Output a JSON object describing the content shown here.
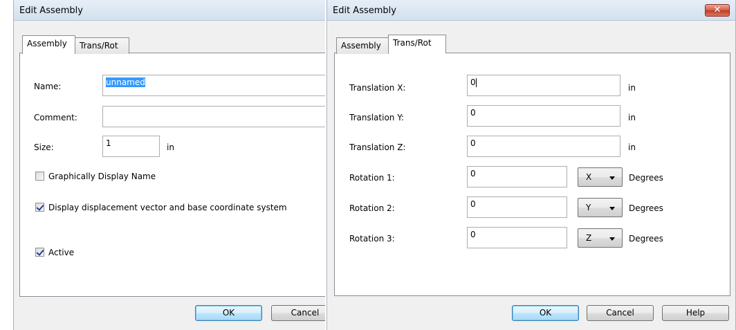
{
  "left_dialog": {
    "title": "Edit Assembly",
    "tabs": [
      {
        "label": "Assembly",
        "active": true
      },
      {
        "label": "Trans/Rot",
        "active": false
      }
    ],
    "fields": {
      "name_label": "Name:",
      "name_value": "unnamed",
      "comment_label": "Comment:",
      "comment_value": "",
      "size_label": "Size:",
      "size_value": "1",
      "size_unit": "in"
    },
    "checkboxes": [
      {
        "label": "Graphically Display Name",
        "checked": false
      },
      {
        "label": "Display displacement vector and base coordinate system",
        "checked": true
      },
      {
        "label": "Active",
        "checked": true
      }
    ],
    "buttons": {
      "ok": "OK",
      "cancel": "Cancel"
    }
  },
  "right_dialog": {
    "title": "Edit Assembly",
    "close_icon": "x-close-icon",
    "tabs": [
      {
        "label": "Assembly",
        "active": false
      },
      {
        "label": "Trans/Rot",
        "active": true
      }
    ],
    "translations": [
      {
        "label": "Translation X:",
        "value": "0",
        "unit": "in"
      },
      {
        "label": "Translation Y:",
        "value": "0",
        "unit": "in"
      },
      {
        "label": "Translation Z:",
        "value": "0",
        "unit": "in"
      }
    ],
    "rotations": [
      {
        "label": "Rotation 1:",
        "value": "0",
        "axis": "X",
        "unit": "Degrees"
      },
      {
        "label": "Rotation 2:",
        "value": "0",
        "axis": "Y",
        "unit": "Degrees"
      },
      {
        "label": "Rotation 3:",
        "value": "0",
        "axis": "Z",
        "unit": "Degrees"
      }
    ],
    "buttons": {
      "ok": "OK",
      "cancel": "Cancel",
      "help": "Help"
    }
  }
}
